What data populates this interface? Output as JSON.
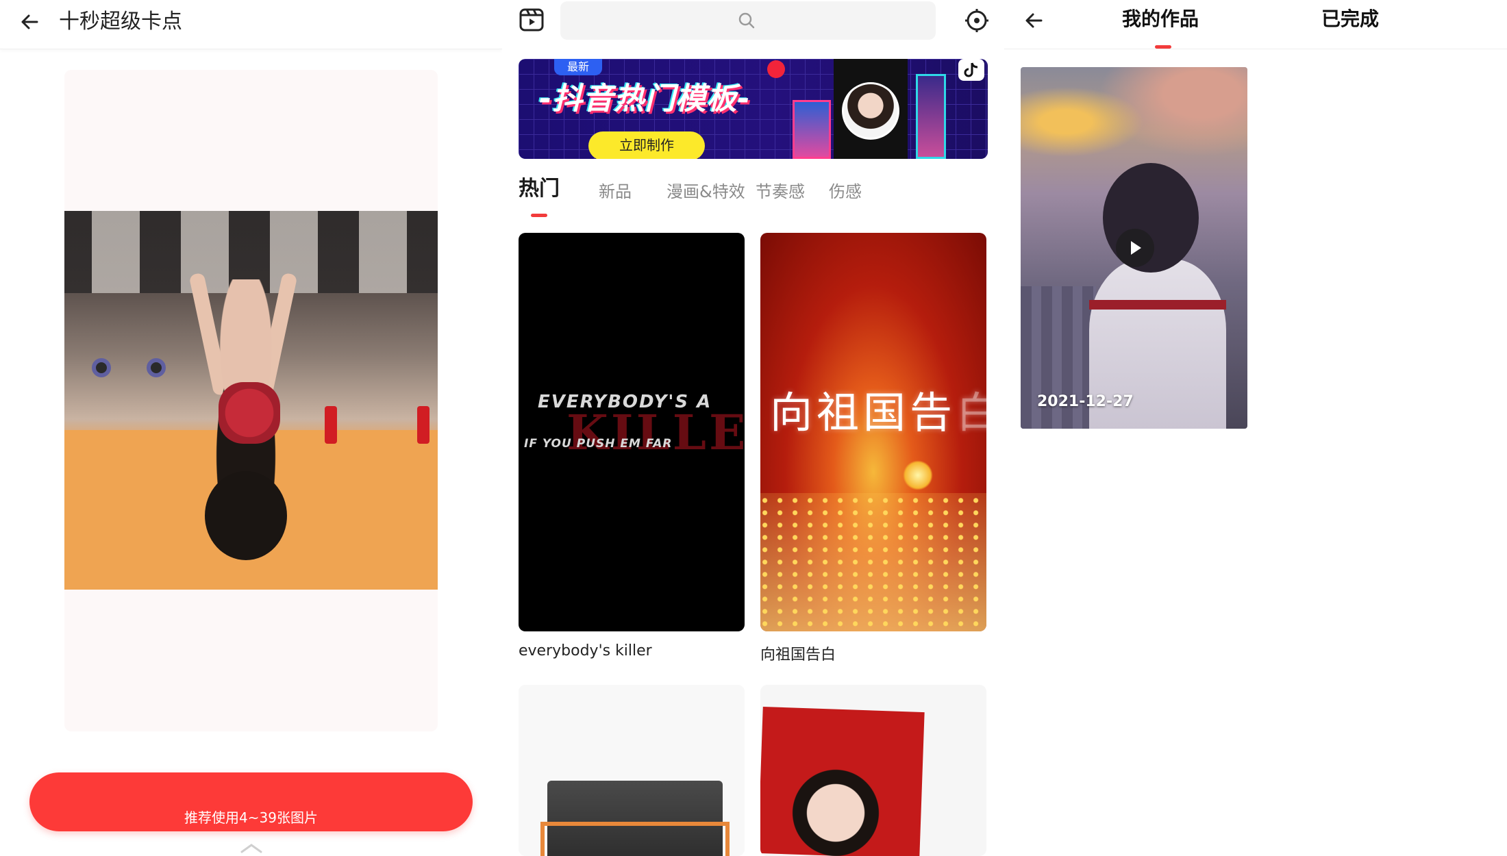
{
  "panel1": {
    "title": "十秒超级卡点",
    "back_icon": "arrow-left-icon",
    "cta_label": "推荐使用4~39张图片",
    "chevron_icon": "chevron-up-icon"
  },
  "panel2": {
    "video_icon": "video-template-icon",
    "search_icon": "search-icon",
    "settings_icon": "settings-icon",
    "banner": {
      "badge": "最新",
      "title": "-抖音热门模板-",
      "button": "立即制作"
    },
    "tabs": [
      {
        "label": "热门",
        "active": true
      },
      {
        "label": "新品",
        "active": false
      },
      {
        "label": "漫画&特效",
        "active": false
      },
      {
        "label": "节奏感",
        "active": false
      },
      {
        "label": "伤感",
        "active": false
      }
    ],
    "cards": [
      {
        "name": "everybody's killer",
        "overlay_line1": "EVERYBODY'S A",
        "overlay_line2": "IF YOU PUSH EM FAR",
        "overlay_big": "KILLER"
      },
      {
        "name": "向祖国告白",
        "overlay_text": "向祖国告",
        "overlay_faded": "白"
      }
    ],
    "accent_color": "#f23b3b"
  },
  "panel3": {
    "back_icon": "arrow-left-icon",
    "tabs": [
      {
        "label": "我的作品",
        "active": true
      },
      {
        "label": "已完成",
        "active": false
      }
    ],
    "work": {
      "date": "2021-12-27",
      "play_icon": "play-icon"
    }
  },
  "colors": {
    "cta": "#fd3a38",
    "tab_indicator": "#f23b3b",
    "banner_button": "#fce92a"
  }
}
